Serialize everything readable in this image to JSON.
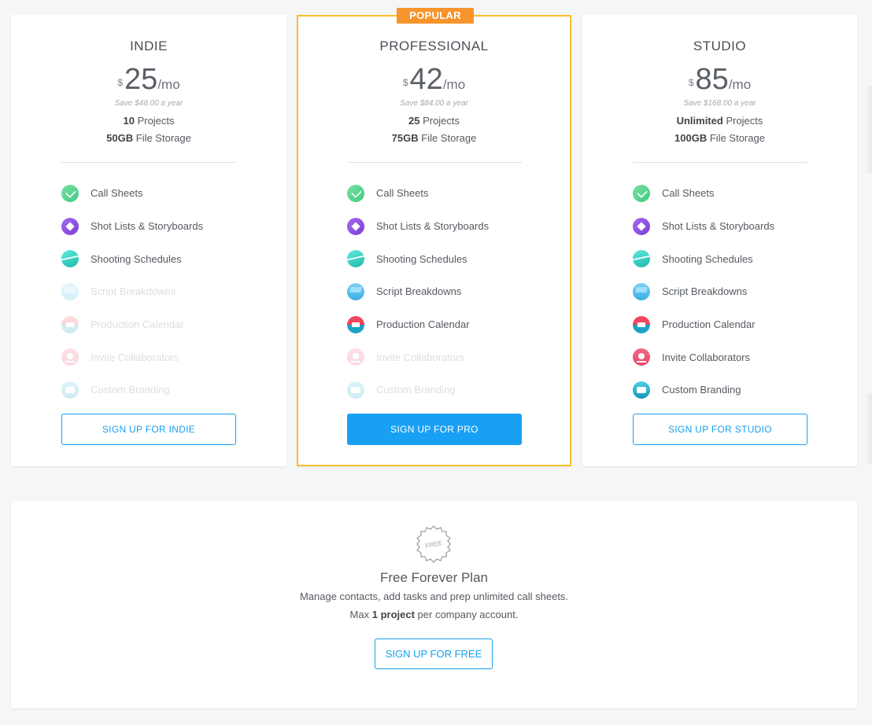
{
  "plans": [
    {
      "name": "INDIE",
      "currency": "$",
      "price": "25",
      "period": "/mo",
      "savings": "Save $48.00 a year",
      "projects_value": "10",
      "projects_label": "Projects",
      "storage_value": "50GB",
      "storage_label": "File Storage",
      "cta": "SIGN UP FOR INDIE",
      "popular": false,
      "features": [
        {
          "label": "Call Sheets",
          "included": true,
          "icon": "call-sheets-icon"
        },
        {
          "label": "Shot Lists & Storyboards",
          "included": true,
          "icon": "shot-lists-icon"
        },
        {
          "label": "Shooting Schedules",
          "included": true,
          "icon": "shooting-schedules-icon"
        },
        {
          "label": "Script Breakdowns",
          "included": false,
          "icon": "script-breakdowns-icon"
        },
        {
          "label": "Production Calendar",
          "included": false,
          "icon": "production-calendar-icon"
        },
        {
          "label": "Invite Collaborators",
          "included": false,
          "icon": "invite-collaborators-icon"
        },
        {
          "label": "Custom Branding",
          "included": false,
          "icon": "custom-branding-icon"
        }
      ]
    },
    {
      "name": "PROFESSIONAL",
      "badge": "POPULAR",
      "currency": "$",
      "price": "42",
      "period": "/mo",
      "savings": "Save $84.00 a year",
      "projects_value": "25",
      "projects_label": "Projects",
      "storage_value": "75GB",
      "storage_label": "File Storage",
      "cta": "SIGN UP FOR PRO",
      "popular": true,
      "features": [
        {
          "label": "Call Sheets",
          "included": true,
          "icon": "call-sheets-icon"
        },
        {
          "label": "Shot Lists & Storyboards",
          "included": true,
          "icon": "shot-lists-icon"
        },
        {
          "label": "Shooting Schedules",
          "included": true,
          "icon": "shooting-schedules-icon"
        },
        {
          "label": "Script Breakdowns",
          "included": true,
          "icon": "script-breakdowns-icon"
        },
        {
          "label": "Production Calendar",
          "included": true,
          "icon": "production-calendar-icon"
        },
        {
          "label": "Invite Collaborators",
          "included": false,
          "icon": "invite-collaborators-icon"
        },
        {
          "label": "Custom Branding",
          "included": false,
          "icon": "custom-branding-icon"
        }
      ]
    },
    {
      "name": "STUDIO",
      "currency": "$",
      "price": "85",
      "period": "/mo",
      "savings": "Save $168.00 a year",
      "projects_value": "Unlimited",
      "projects_label": "Projects",
      "storage_value": "100GB",
      "storage_label": "File Storage",
      "cta": "SIGN UP FOR STUDIO",
      "popular": false,
      "features": [
        {
          "label": "Call Sheets",
          "included": true,
          "icon": "call-sheets-icon"
        },
        {
          "label": "Shot Lists & Storyboards",
          "included": true,
          "icon": "shot-lists-icon"
        },
        {
          "label": "Shooting Schedules",
          "included": true,
          "icon": "shooting-schedules-icon"
        },
        {
          "label": "Script Breakdowns",
          "included": true,
          "icon": "script-breakdowns-icon"
        },
        {
          "label": "Production Calendar",
          "included": true,
          "icon": "production-calendar-icon"
        },
        {
          "label": "Invite Collaborators",
          "included": true,
          "icon": "invite-collaborators-icon"
        },
        {
          "label": "Custom Branding",
          "included": true,
          "icon": "custom-branding-icon"
        }
      ]
    }
  ],
  "free_plan": {
    "badge_text": "FREE",
    "title": "Free Forever Plan",
    "description": "Manage contacts, add tasks and prep unlimited call sheets.",
    "max_prefix": "Max",
    "max_value": "1 project",
    "max_suffix": "per company account.",
    "cta": "SIGN UP FOR FREE"
  },
  "colors": {
    "accent": "#18a0f5",
    "popular_border": "#f9bf2c",
    "popular_badge": "#f7942b",
    "background": "#f4f6f8"
  }
}
